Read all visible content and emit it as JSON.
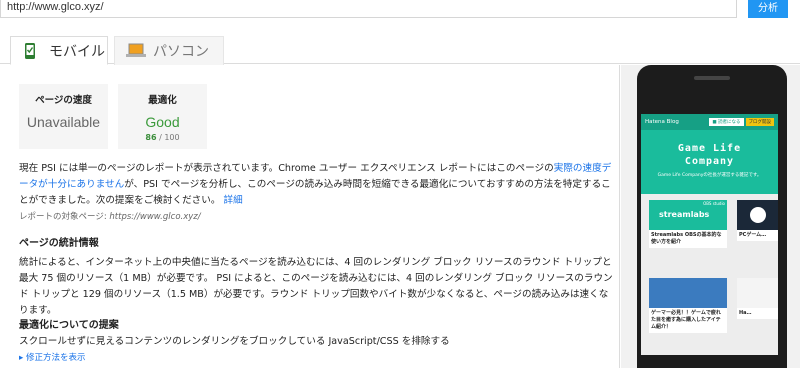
{
  "url_bar": {
    "value": "http://www.glco.xyz/",
    "button": "分析"
  },
  "tabs": [
    {
      "label": "モバイル",
      "icon": "mobile-phone-icon",
      "active": true
    },
    {
      "label": "パソコン",
      "icon": "laptop-icon",
      "active": false
    }
  ],
  "scores": {
    "speed": {
      "heading": "ページの速度",
      "value": "Unavailable"
    },
    "optimization": {
      "heading": "最適化",
      "value": "Good",
      "score": "86",
      "max": "/ 100"
    }
  },
  "summary": {
    "text_before": "現在 PSI には単一のページのレポートが表示されています。Chrome ユーザー エクスペリエンス レポートにはこのページの",
    "link": "実際の速度データが十分にありません",
    "text_after": "が、PSI でページを分析し、このページの読み込み時間を短縮できる最適化についておすすめの方法を特定することができました。次の提案をご検討ください。",
    "detail_link": "詳細"
  },
  "target": {
    "label": "レポートの対象ページ:",
    "url": "https://www.glco.xyz/"
  },
  "stats": {
    "heading": "ページの統計情報",
    "body": "統計によると、インターネット上の中央値に当たるページを読み込むには、4 回のレンダリング ブロック リソースのラウンド トリップと最大 75 個のリソース（1 MB）が必要です。 PSI によると、このページを読み込むには、4 回のレンダリング ブロック リソースのラウンド トリップと 129 個のリソース（1.5 MB）が必要です。ラウンド トリップ回数やバイト数が少なくなると、ページの読み込みは速くなります。"
  },
  "suggestions": {
    "heading": "最適化についての提案",
    "item": "スクロールせずに見えるコンテンツのレンダリングをブロックしている JavaScript/CSS を排除する",
    "fix_link": "▸ 修正方法を表示"
  },
  "preview": {
    "blog_name": "Hatena Blog",
    "btn1": "■ 読者になる",
    "btn2": "ブログ開設",
    "title_line1": "Game Life",
    "title_line2": "Company",
    "subtitle": "Game Life Companyの社長が運営する雑記です。",
    "card1_badge": "OBS studio",
    "card1_logo": "streamlabs",
    "card1_title": "Streamlabs OBSの基本的な使い方を紹介",
    "card2_title": "PCゲーム…",
    "card3_title": "ゲーマー必見！！ゲームで疲れた目を癒す為に購入したアイテム紹介！",
    "card4_title": "Ha…",
    "colors": {
      "accent": "#1abc9c",
      "link": "#1a73e8",
      "good": "#3b9a3b",
      "button": "#2196f3"
    }
  }
}
